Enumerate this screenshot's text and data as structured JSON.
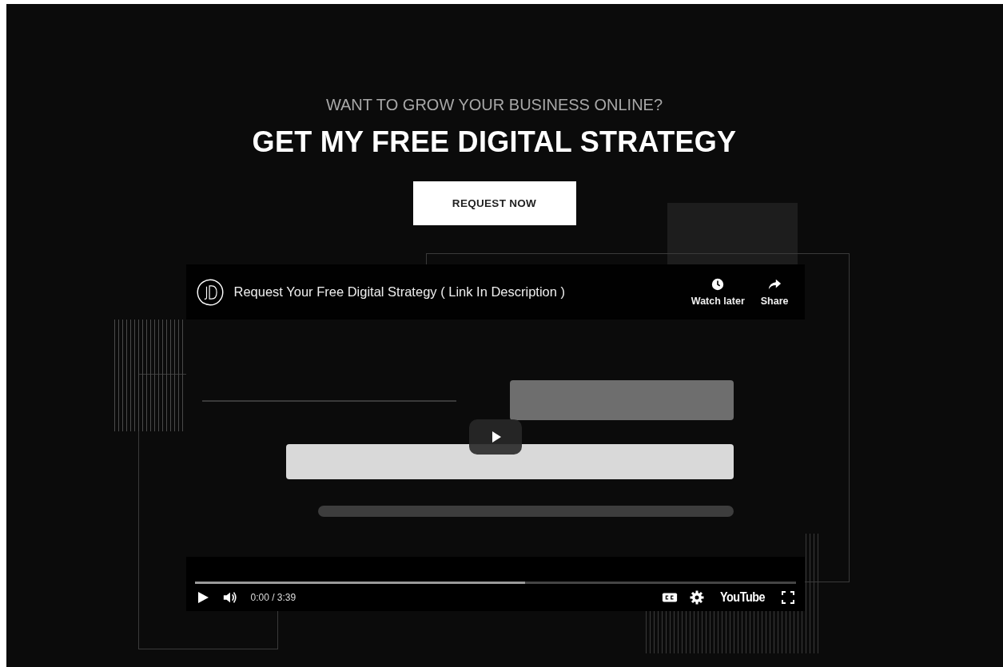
{
  "hero": {
    "eyebrow": "WANT TO GROW YOUR BUSINESS ONLINE?",
    "heading": "GET MY FREE DIGITAL STRATEGY",
    "button": "REQUEST NOW"
  },
  "video": {
    "kind": "picture",
    "title": "Request Your Free Digital Strategy ( Link In Description )",
    "actions": [
      {
        "kind": "watch-later",
        "label": "Watch later"
      },
      {
        "kind": "share",
        "label": "Share"
      }
    ],
    "progress": {
      "level": 0.55
    },
    "time": "0:00 / 3:39",
    "brand": "YouTube"
  }
}
